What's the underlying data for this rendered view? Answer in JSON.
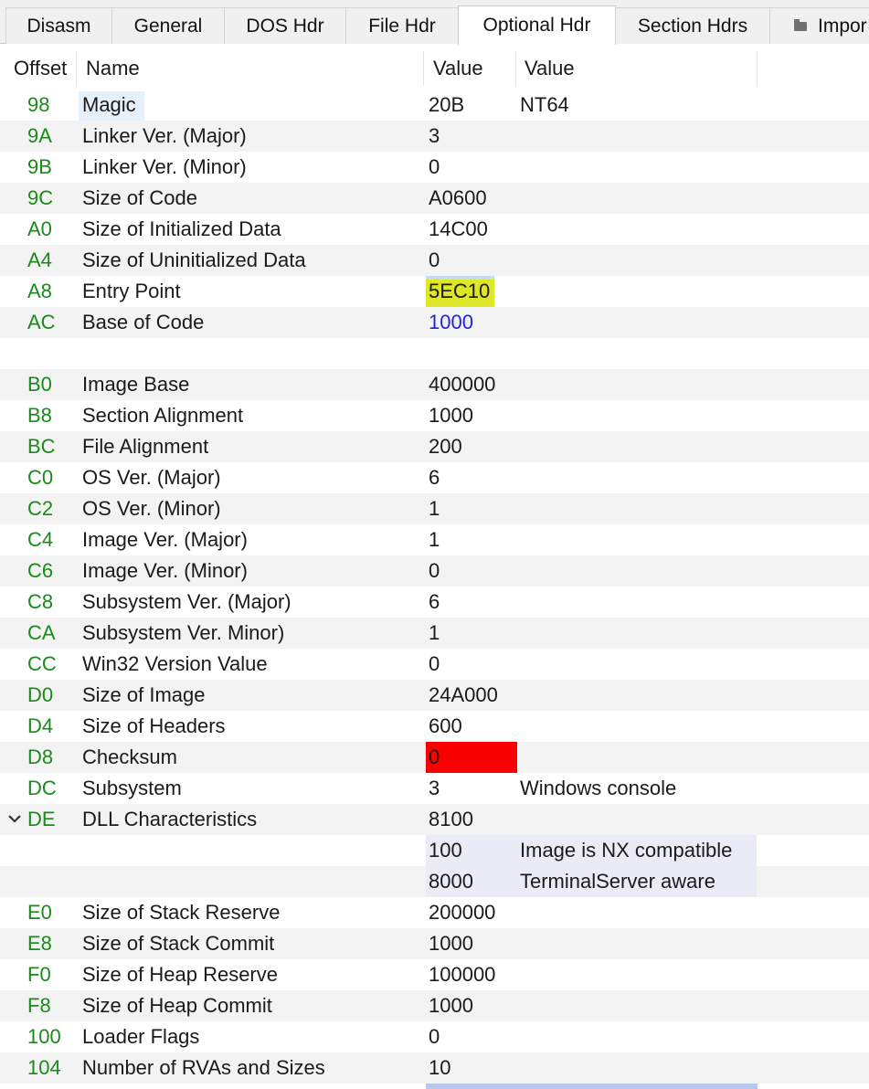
{
  "tabs": [
    {
      "label": "Disasm"
    },
    {
      "label": "General"
    },
    {
      "label": "DOS Hdr"
    },
    {
      "label": "File Hdr"
    },
    {
      "label": "Optional Hdr"
    },
    {
      "label": "Section Hdrs"
    },
    {
      "label": "Impor"
    }
  ],
  "header": {
    "offset": "Offset",
    "name": "Name",
    "value": "Value",
    "value2": "Value"
  },
  "rows": [
    {
      "offset": "98",
      "name": "Magic",
      "value": "20B",
      "value2": "NT64"
    },
    {
      "offset": "9A",
      "name": "Linker Ver. (Major)",
      "value": "3",
      "value2": ""
    },
    {
      "offset": "9B",
      "name": "Linker Ver. (Minor)",
      "value": "0",
      "value2": ""
    },
    {
      "offset": "9C",
      "name": "Size of Code",
      "value": "A0600",
      "value2": ""
    },
    {
      "offset": "A0",
      "name": "Size of Initialized Data",
      "value": "14C00",
      "value2": ""
    },
    {
      "offset": "A4",
      "name": "Size of Uninitialized Data",
      "value": "0",
      "value2": ""
    },
    {
      "offset": "A8",
      "name": "Entry Point",
      "value": "5EC10",
      "value2": ""
    },
    {
      "offset": "AC",
      "name": "Base of Code",
      "value": "1000",
      "value2": ""
    },
    {
      "offset": "",
      "name": "",
      "value": "",
      "value2": ""
    },
    {
      "offset": "B0",
      "name": "Image Base",
      "value": "400000",
      "value2": ""
    },
    {
      "offset": "B8",
      "name": "Section Alignment",
      "value": "1000",
      "value2": ""
    },
    {
      "offset": "BC",
      "name": "File Alignment",
      "value": "200",
      "value2": ""
    },
    {
      "offset": "C0",
      "name": "OS Ver. (Major)",
      "value": "6",
      "value2": ""
    },
    {
      "offset": "C2",
      "name": "OS Ver. (Minor)",
      "value": "1",
      "value2": ""
    },
    {
      "offset": "C4",
      "name": "Image Ver. (Major)",
      "value": "1",
      "value2": ""
    },
    {
      "offset": "C6",
      "name": "Image Ver. (Minor)",
      "value": "0",
      "value2": ""
    },
    {
      "offset": "C8",
      "name": "Subsystem Ver. (Major)",
      "value": "6",
      "value2": ""
    },
    {
      "offset": "CA",
      "name": "Subsystem Ver. Minor)",
      "value": "1",
      "value2": ""
    },
    {
      "offset": "CC",
      "name": "Win32 Version Value",
      "value": "0",
      "value2": ""
    },
    {
      "offset": "D0",
      "name": "Size of Image",
      "value": "24A000",
      "value2": ""
    },
    {
      "offset": "D4",
      "name": "Size of Headers",
      "value": "600",
      "value2": ""
    },
    {
      "offset": "D8",
      "name": "Checksum",
      "value": "0",
      "value2": ""
    },
    {
      "offset": "DC",
      "name": "Subsystem",
      "value": "3",
      "value2": "Windows console"
    },
    {
      "offset": "DE",
      "name": "DLL Characteristics",
      "value": "8100",
      "value2": ""
    },
    {
      "offset": "",
      "name": "",
      "value": "100",
      "value2": "Image is NX compatible"
    },
    {
      "offset": "",
      "name": "",
      "value": "8000",
      "value2": "TerminalServer aware"
    },
    {
      "offset": "E0",
      "name": "Size of Stack Reserve",
      "value": "200000",
      "value2": ""
    },
    {
      "offset": "E8",
      "name": "Size of Stack Commit",
      "value": "1000",
      "value2": ""
    },
    {
      "offset": "F0",
      "name": "Size of Heap Reserve",
      "value": "100000",
      "value2": ""
    },
    {
      "offset": "F8",
      "name": "Size of Heap Commit",
      "value": "1000",
      "value2": ""
    },
    {
      "offset": "100",
      "name": "Loader Flags",
      "value": "0",
      "value2": ""
    },
    {
      "offset": "104",
      "name": "Number of RVAs and Sizes",
      "value": "10",
      "value2": ""
    }
  ],
  "colors": {
    "offset_text": "#1a8a1a",
    "entry_point_highlight": "#dde627",
    "checksum_highlight": "#fb0000",
    "link_value": "#2222dd"
  },
  "icons": {
    "imports_tab": "folder-icon",
    "expand": "chevron-down-icon"
  }
}
